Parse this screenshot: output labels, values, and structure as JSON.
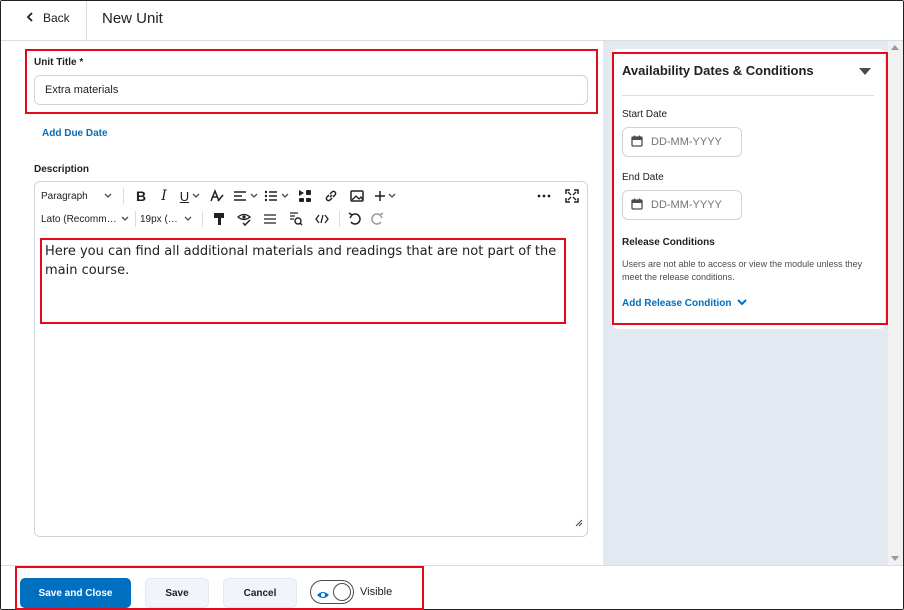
{
  "header": {
    "back_label": "Back",
    "title": "New Unit"
  },
  "form": {
    "unit_title_label": "Unit Title *",
    "unit_title_value": "Extra materials",
    "add_due_date": "Add Due Date",
    "description_label": "Description"
  },
  "editor": {
    "paragraph_format": "Paragraph",
    "font_family": "Lato (Recomm…",
    "font_size": "19px (…",
    "content": "Here you can find all additional materials and readings that are not part of the main course."
  },
  "availability": {
    "title": "Availability Dates & Conditions",
    "start_date_label": "Start Date",
    "start_date_placeholder": "DD-MM-YYYY",
    "end_date_label": "End Date",
    "end_date_placeholder": "DD-MM-YYYY",
    "release_conditions_label": "Release Conditions",
    "release_conditions_text": "Users are not able to access or view the module unless they meet the release conditions.",
    "add_release_condition": "Add Release Condition"
  },
  "footer": {
    "save_and_close": "Save and Close",
    "save": "Save",
    "cancel": "Cancel",
    "visible_label": "Visible"
  },
  "colors": {
    "accent": "#006fbf",
    "highlight": "#e00b1c",
    "side_panel_bg": "#e3e9f1"
  }
}
